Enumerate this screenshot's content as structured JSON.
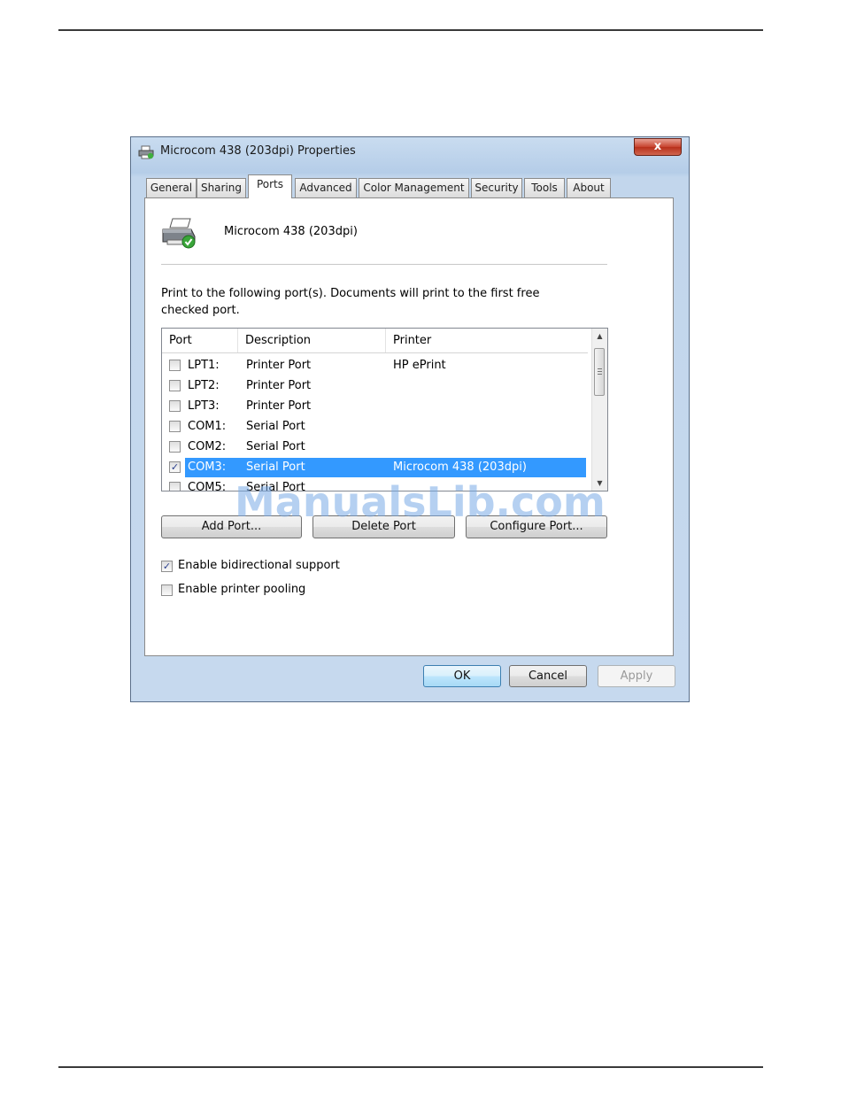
{
  "window": {
    "title": "Microcom 438 (203dpi) Properties",
    "close_glyph": "x"
  },
  "tabs": [
    {
      "label": "General"
    },
    {
      "label": "Sharing"
    },
    {
      "label": "Ports"
    },
    {
      "label": "Advanced"
    },
    {
      "label": "Color Management"
    },
    {
      "label": "Security"
    },
    {
      "label": "Tools"
    },
    {
      "label": "About"
    }
  ],
  "active_tab": "Ports",
  "printer": {
    "name": "Microcom 438 (203dpi)",
    "icon": "printer-icon"
  },
  "description_line1": "Print to the following port(s). Documents will print to the first free",
  "description_line2": "checked port.",
  "port_list": {
    "columns": [
      "Port",
      "Description",
      "Printer"
    ],
    "rows": [
      {
        "checked": false,
        "port": "LPT1:",
        "description": "Printer Port",
        "printer": "HP ePrint",
        "selected": false
      },
      {
        "checked": false,
        "port": "LPT2:",
        "description": "Printer Port",
        "printer": "",
        "selected": false
      },
      {
        "checked": false,
        "port": "LPT3:",
        "description": "Printer Port",
        "printer": "",
        "selected": false
      },
      {
        "checked": false,
        "port": "COM1:",
        "description": "Serial Port",
        "printer": "",
        "selected": false
      },
      {
        "checked": false,
        "port": "COM2:",
        "description": "Serial Port",
        "printer": "",
        "selected": false
      },
      {
        "checked": true,
        "port": "COM3:",
        "description": "Serial Port",
        "printer": "Microcom 438 (203dpi)",
        "selected": true
      },
      {
        "checked": false,
        "port": "COM5:",
        "description": "Serial Port",
        "printer": "",
        "selected": false
      }
    ]
  },
  "buttons": {
    "add_port": "Add Port...",
    "delete_port": "Delete Port",
    "configure_port": "Configure Port...",
    "ok": "OK",
    "cancel": "Cancel",
    "apply": "Apply"
  },
  "options": {
    "bidirectional": {
      "label": "Enable bidirectional support",
      "checked": true
    },
    "pooling": {
      "label": "Enable printer pooling",
      "checked": false
    }
  },
  "watermark": "ManualsLib.com",
  "colors": {
    "selection": "#3399ff",
    "title_bar": "#c9dcf0",
    "close_button": "#c7432e"
  }
}
